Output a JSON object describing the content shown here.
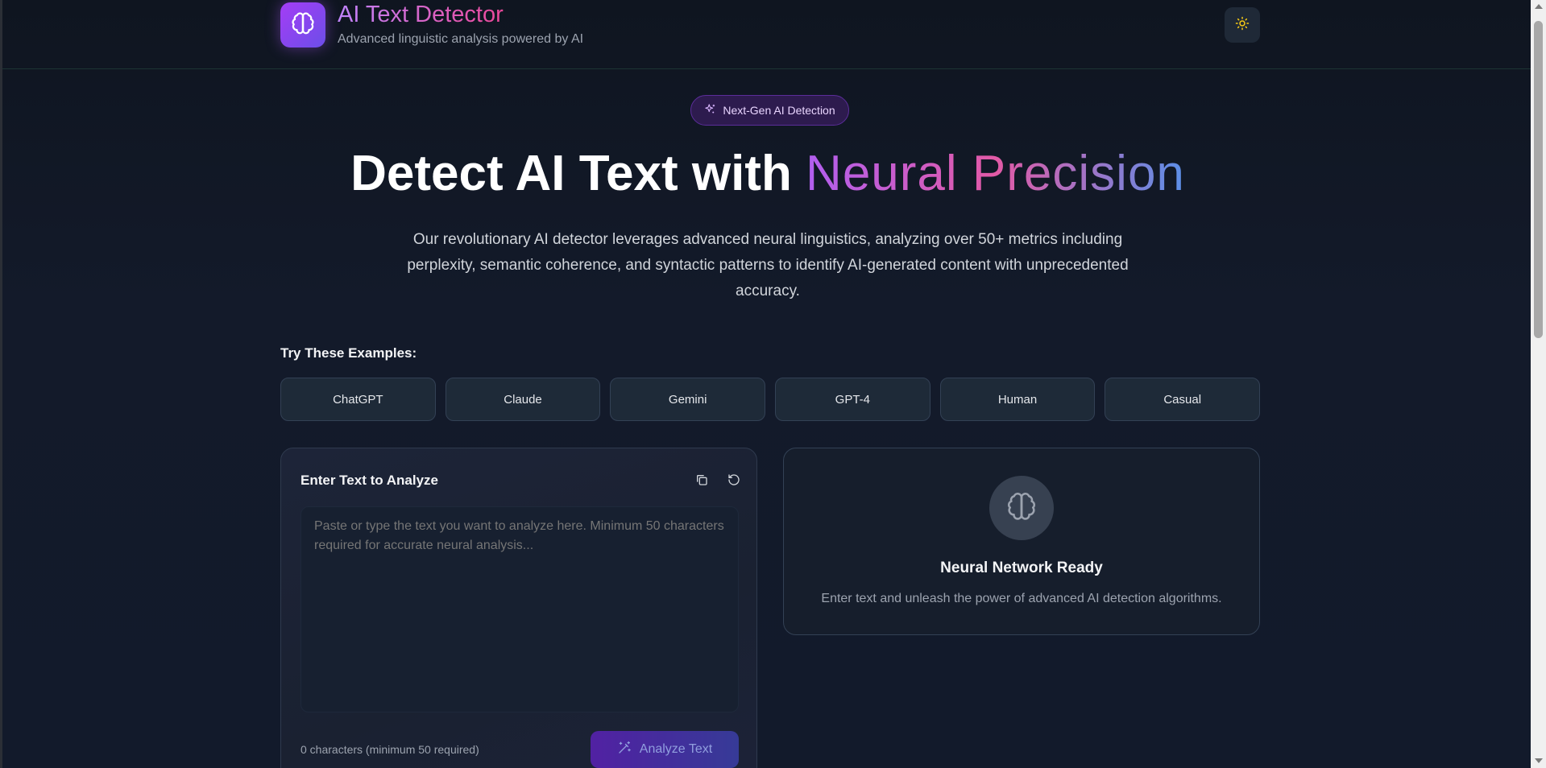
{
  "header": {
    "title": "AI Text Detector",
    "subtitle": "Advanced linguistic analysis powered by AI",
    "logo_icon": "brain-icon",
    "theme_toggle_icon": "sun-icon"
  },
  "hero": {
    "badge": "Next-Gen AI Detection",
    "badge_icon": "sparkles-icon",
    "title_plain": "Detect AI Text with ",
    "title_gradient": "Neural Precision",
    "description": "Our revolutionary AI detector leverages advanced neural linguistics, analyzing over 50+ metrics including perplexity, semantic coherence, and syntactic patterns to identify AI-generated content with unprecedented accuracy."
  },
  "examples": {
    "label": "Try These Examples:",
    "items": [
      "ChatGPT",
      "Claude",
      "Gemini",
      "GPT-4",
      "Human",
      "Casual"
    ]
  },
  "input": {
    "title": "Enter Text to Analyze",
    "placeholder": "Paste or type the text you want to analyze here. Minimum 50 characters required for accurate neural analysis...",
    "value": "",
    "char_count": "0 characters (minimum 50 required)",
    "analyze_label": "Analyze Text",
    "analyze_icon": "magic-wand-icon",
    "copy_icon": "copy-icon",
    "reset_icon": "reset-icon"
  },
  "status": {
    "title": "Neural Network Ready",
    "description": "Enter text and unleash the power of advanced AI detection algorithms.",
    "icon": "brain-icon"
  },
  "colors": {
    "accent_purple": "#a855f7",
    "accent_pink": "#ec4899",
    "accent_blue": "#5b8fe8",
    "background": "#111827"
  }
}
